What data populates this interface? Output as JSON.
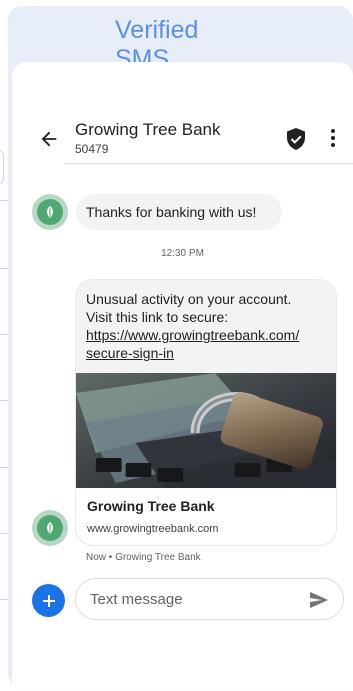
{
  "banner": {
    "title_line1": "Verified",
    "title_line2": "SMS"
  },
  "conversation": {
    "sender_name": "Growing Tree Bank",
    "sender_number": "50479",
    "icons": {
      "back": "back-arrow-icon",
      "verified": "verified-shield-icon",
      "menu": "more-vertical-icon",
      "avatar": "leaf-logo-icon",
      "add": "plus-icon",
      "send": "send-icon"
    }
  },
  "messages": [
    {
      "text": "Thanks for banking with us!"
    }
  ],
  "timestamp": "12:30 PM",
  "rich_card": {
    "text_line1": "Unusual activity on your account.",
    "text_line2": "Visit this link to secure:",
    "link_line1": "https://www.growingtreebank.com/",
    "link_line2": "secure-sign-in",
    "preview_title": "Growing Tree Bank",
    "preview_url": "www.growingtreebank.com"
  },
  "footnote": "Now • Growing Tree Bank",
  "composer": {
    "placeholder": "Text message"
  },
  "colors": {
    "accent": "#1a73e8",
    "banner_text": "#5b8fe8",
    "avatar_green": "#4fa872",
    "bubble": "#f1f3f4",
    "card_bg": "#e8eef9"
  }
}
